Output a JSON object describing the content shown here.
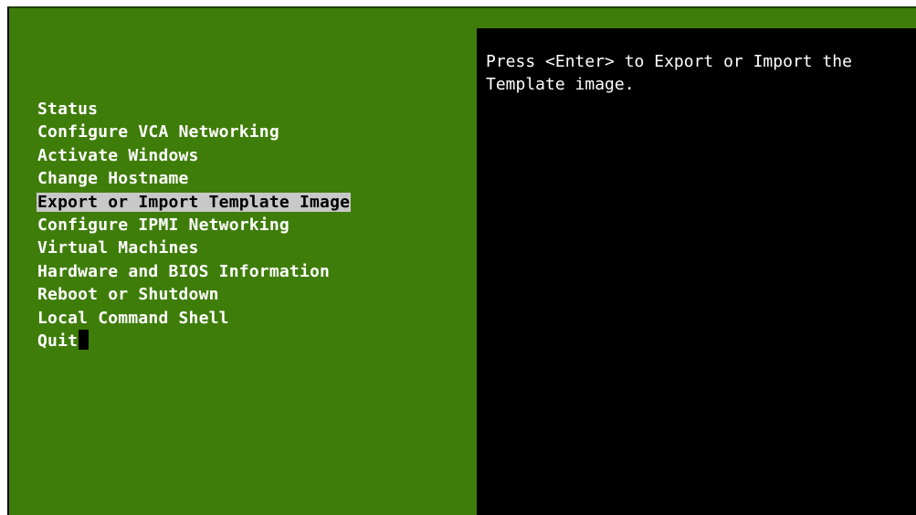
{
  "menu": {
    "items": [
      {
        "label": "Status"
      },
      {
        "label": "Configure VCA Networking"
      },
      {
        "label": "Activate Windows"
      },
      {
        "label": "Change Hostname"
      },
      {
        "label": "Export or Import Template Image",
        "selected": true
      },
      {
        "label": "Configure IPMI Networking"
      },
      {
        "label": "Virtual Machines"
      },
      {
        "label": "Hardware and BIOS Information"
      },
      {
        "label": "Reboot or Shutdown"
      },
      {
        "label": "Local Command Shell"
      },
      {
        "label": "Quit"
      }
    ]
  },
  "help": {
    "line1": "Press <Enter> to Export or Import the",
    "line2": "Template image."
  },
  "colors": {
    "background": "#3f7d0a",
    "panel": "#000000",
    "highlight": "#c8c8c8",
    "text": "#ffffff"
  }
}
